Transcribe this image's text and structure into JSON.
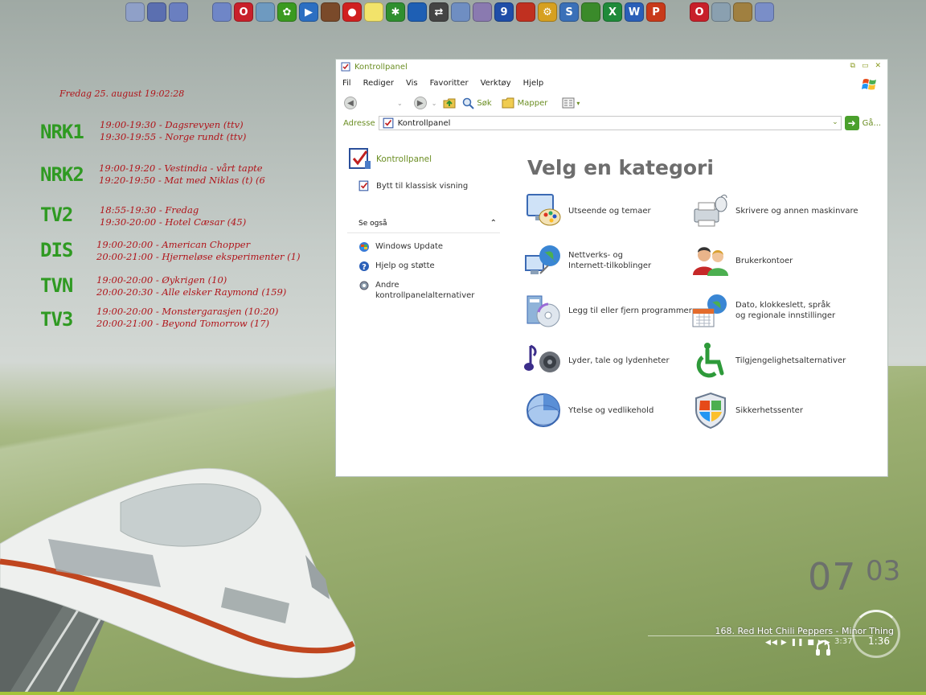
{
  "desktop": {
    "topbar_icons": [
      {
        "name": "recycle-bin-icon",
        "color": "#8fa0c8",
        "glyph": ""
      },
      {
        "name": "book-icon",
        "color": "#5b6fb0",
        "glyph": ""
      },
      {
        "name": "notebook-icon",
        "color": "#6a7fc0",
        "glyph": ""
      },
      {
        "name": "gap"
      },
      {
        "name": "mail-icon",
        "color": "#6f86c7",
        "glyph": ""
      },
      {
        "name": "opera-icon",
        "color": "#c8202a",
        "glyph": "O"
      },
      {
        "name": "users-icon",
        "color": "#6e9ac0",
        "glyph": ""
      },
      {
        "name": "icq-icon",
        "color": "#3a9a20",
        "glyph": "✿"
      },
      {
        "name": "media-player-icon",
        "color": "#2c6fc2",
        "glyph": "▶"
      },
      {
        "name": "film-icon",
        "color": "#7a4a2a",
        "glyph": ""
      },
      {
        "name": "record-icon",
        "color": "#d02020",
        "glyph": "●"
      },
      {
        "name": "note-icon",
        "color": "#f2e36a",
        "glyph": ""
      },
      {
        "name": "gear-green-icon",
        "color": "#2f8f2f",
        "glyph": "✱"
      },
      {
        "name": "bird-icon",
        "color": "#1e5fb4",
        "glyph": ""
      },
      {
        "name": "arrows-icon",
        "color": "#444444",
        "glyph": "⇄"
      },
      {
        "name": "camera-icon",
        "color": "#6f8ec2",
        "glyph": ""
      },
      {
        "name": "brush-icon",
        "color": "#8a7ab0",
        "glyph": ""
      },
      {
        "name": "nine-icon",
        "color": "#1f4ea8",
        "glyph": "9"
      },
      {
        "name": "burner-icon",
        "color": "#c03020",
        "glyph": ""
      },
      {
        "name": "settings-icon",
        "color": "#d6a020",
        "glyph": "⚙"
      },
      {
        "name": "skype-icon",
        "color": "#3a70b8",
        "glyph": "S"
      },
      {
        "name": "chart-icon",
        "color": "#3a8a2a",
        "glyph": ""
      },
      {
        "name": "excel-icon",
        "color": "#1f8a3a",
        "glyph": "X"
      },
      {
        "name": "word-icon",
        "color": "#2a5fb8",
        "glyph": "W"
      },
      {
        "name": "powerpoint-icon",
        "color": "#c83a1a",
        "glyph": "P"
      },
      {
        "name": "gap"
      },
      {
        "name": "opera-2-icon",
        "color": "#c8202a",
        "glyph": "O"
      },
      {
        "name": "monitor-icon",
        "color": "#8aa0b0",
        "glyph": ""
      },
      {
        "name": "pencils-icon",
        "color": "#a08040",
        "glyph": ""
      },
      {
        "name": "folder-blue-icon",
        "color": "#7a8ec8",
        "glyph": ""
      }
    ],
    "tvguide": {
      "date": "Fredag 25. august 19:02:28",
      "channels": [
        {
          "name": "NRK1",
          "lines": [
            "19:00-19:30 - Dagsrevyen (ttv)",
            "19:30-19:55 - Norge rundt (ttv)"
          ]
        },
        {
          "name": "NRK2",
          "lines": [
            "19:00-19:20 - Vestindia - vårt tapte",
            "19:20-19:50 - Mat med Niklas (t) (6"
          ]
        },
        {
          "name": "TV2",
          "lines": [
            "18:55-19:30 - Fredag",
            "19:30-20:00 - Hotel Cæsar (45)"
          ]
        },
        {
          "name": "DIS",
          "lines": [
            "19:00-20:00 - American Chopper",
            "20:00-21:00 - Hjerneløse eksperimenter (1)"
          ]
        },
        {
          "name": "TVN",
          "lines": [
            "19:00-20:00 - Øykrigen (10)",
            "20:00-20:30 - Alle elsker Raymond (159)"
          ]
        },
        {
          "name": "TV3",
          "lines": [
            "19:00-20:00 - Monstergarasjen (10:20)",
            "20:00-21:00 - Beyond Tomorrow (17)"
          ]
        }
      ]
    },
    "clock": {
      "hours": "07",
      "minutes": "03"
    },
    "player": {
      "track": "168. Red Hot Chili Peppers - Minor Thing",
      "total": "3:37",
      "elapsed": "1:36",
      "controls": "◀◀ ▶ ❚❚ ■ ▶▶"
    }
  },
  "window": {
    "title": "Kontrollpanel",
    "menu": [
      "Fil",
      "Rediger",
      "Vis",
      "Favoritter",
      "Verktøy",
      "Hjelp"
    ],
    "toolbar": {
      "search": "Søk",
      "folders": "Mapper"
    },
    "address": {
      "label": "Adresse",
      "value": "Kontrollpanel",
      "go": "Gå..."
    },
    "left": {
      "title": "Kontrollpanel",
      "switch": "Bytt til klassisk visning",
      "see_also": "Se også",
      "items": [
        "Windows Update",
        "Hjelp og støtte",
        "Andre kontrollpanelalternativer"
      ]
    },
    "heading": "Velg en kategori",
    "categories": [
      {
        "label": "Utseende og temaer"
      },
      {
        "label": "Skrivere og annen maskinvare"
      },
      {
        "label": "Nettverks- og Internett-tilkoblinger"
      },
      {
        "label": "Brukerkontoer"
      },
      {
        "label": "Legg til eller fjern programmer"
      },
      {
        "label": "Dato, klokkeslett, språk og regionale innstillinger"
      },
      {
        "label": "Lyder, tale og lydenheter"
      },
      {
        "label": "Tilgjengelighetsalternativer"
      },
      {
        "label": "Ytelse og vedlikehold"
      },
      {
        "label": "Sikkerhetssenter"
      }
    ]
  }
}
